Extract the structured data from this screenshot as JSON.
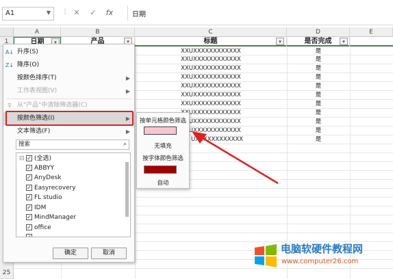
{
  "formula_bar": {
    "name_box": "A1",
    "cancel_glyph": "✕",
    "enter_glyph": "✓",
    "fx_glyph": "fx",
    "value": "日期"
  },
  "columns": [
    "A",
    "B",
    "C",
    "D",
    "E"
  ],
  "rows": {
    "visible_top": "1",
    "visible_bottom": "25"
  },
  "header_row": {
    "a": "日期",
    "b": "产品",
    "c": "标题",
    "d": "是否完成"
  },
  "data": {
    "title_values": [
      "XXUXXXXXXXXXXXX",
      "XXUXXXXXXXXXXXX",
      "XXUXXXXXXXXXXXX",
      "XXUXXXXXXXXXXXX",
      "XXUXXXXXXXXXXXX",
      "XXUXXXXXXXXXXXX",
      "XXUXXXXXXXXXXXX",
      "XXUXXXXXXXXXXXX",
      "XXUXXXXXXXXXXXX",
      "XXUXXXXXXXXXXXX",
      "UXXXXXXXXXXXX"
    ],
    "done_values": [
      "是",
      "是",
      "是",
      "是",
      "是",
      "是",
      "是",
      "是",
      "是",
      "是",
      "是"
    ]
  },
  "filter_menu": {
    "sort_asc": "升序(S)",
    "sort_desc": "降序(O)",
    "sort_by_color": "按颜色排序(T)",
    "sheet_view": "工作表视图(V)",
    "clear_filter": "从\"产品\"中清除筛选器(C)",
    "filter_by_color": "按颜色筛选(I)",
    "text_filter": "文本筛选(F)",
    "search_placeholder": "搜索",
    "items": [
      "(全选)",
      "ABBYY",
      "AnyDesk",
      "Easyrecovery",
      "FL studio",
      "IDM",
      "MindManager",
      "office",
      "..."
    ],
    "ok": "确定",
    "cancel": "取消"
  },
  "color_submenu": {
    "by_cell_color": "按单元格颜色筛选",
    "cell_color": "#f7c6cc",
    "no_fill": "无填充",
    "by_font_color": "按字体颜色筛选",
    "font_color": "#a00000",
    "auto": "自动"
  },
  "watermark": {
    "title": "电脑软硬件教程网",
    "url": "www.computer26.com"
  },
  "colors": {
    "highlight_red": "#e02020",
    "header_underline": "#4f7a4f"
  }
}
